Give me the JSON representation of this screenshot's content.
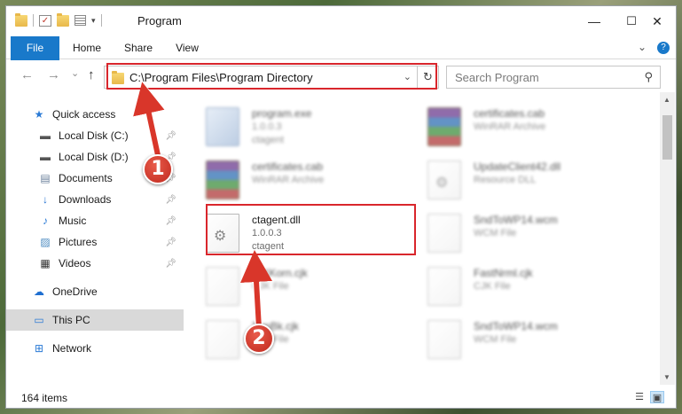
{
  "window": {
    "title": "Program",
    "controls": {
      "minimize": "—",
      "maximize": "☐",
      "close": "✕"
    }
  },
  "ribbon": {
    "tabs": [
      "File",
      "Home",
      "Share",
      "View"
    ],
    "expand_icon": "chevron-down-icon",
    "help_icon": "help-icon"
  },
  "nav": {
    "back": "←",
    "forward": "→",
    "recent": "⌄",
    "up": "↑",
    "address": "C:\\Program Files\\Program Directory",
    "refresh": "↻",
    "search_placeholder": "Search Program"
  },
  "sidebar": {
    "items": [
      {
        "label": "Quick access",
        "icon": "star-icon",
        "pinned": false
      },
      {
        "label": "Local Disk (C:)",
        "icon": "drive-icon",
        "pinned": true
      },
      {
        "label": "Local Disk (D:)",
        "icon": "drive-icon",
        "pinned": true
      },
      {
        "label": "Documents",
        "icon": "documents-icon",
        "pinned": true
      },
      {
        "label": "Downloads",
        "icon": "downloads-icon",
        "pinned": true
      },
      {
        "label": "Music",
        "icon": "music-icon",
        "pinned": true
      },
      {
        "label": "Pictures",
        "icon": "pictures-icon",
        "pinned": true
      },
      {
        "label": "Videos",
        "icon": "videos-icon",
        "pinned": true
      },
      {
        "label": "OneDrive",
        "icon": "cloud-icon",
        "pinned": false
      },
      {
        "label": "This PC",
        "icon": "computer-icon",
        "pinned": false,
        "selected": true
      },
      {
        "label": "Network",
        "icon": "network-icon",
        "pinned": false
      }
    ]
  },
  "files": [
    {
      "name": "program.exe",
      "line1": "1.0.0.3",
      "line2": "ctagent",
      "type": "exe",
      "blurred": true
    },
    {
      "name": "certificates.cab",
      "line1": "WinRAR Archive",
      "line2": "",
      "type": "archive",
      "blurred": true
    },
    {
      "name": "certificates.cab",
      "line1": "WinRAR Archive",
      "line2": "",
      "type": "archive",
      "blurred": true
    },
    {
      "name": "UpdateClient42.dll",
      "line1": "Resource DLL",
      "line2": "",
      "type": "dll",
      "blurred": true
    },
    {
      "name": "ctagent.dll",
      "line1": "1.0.0.3",
      "line2": "ctagent",
      "type": "dll",
      "blurred": false
    },
    {
      "name": "SndToWP14.wcm",
      "line1": "WCM File",
      "line2": "",
      "type": "generic",
      "blurred": true
    },
    {
      "name": "IEXKorn.cjk",
      "line1": "CJK File",
      "line2": "",
      "type": "generic",
      "blurred": true
    },
    {
      "name": "FastNrml.cjk",
      "line1": "CJK File",
      "line2": "",
      "type": "generic",
      "blurred": true
    },
    {
      "name": "TrmBk.cjk",
      "line1": "CJK File",
      "line2": "",
      "type": "generic",
      "blurred": true
    },
    {
      "name": "SndToWP14.wcm",
      "line1": "WCM File",
      "line2": "",
      "type": "generic",
      "blurred": true
    }
  ],
  "status": {
    "count": "164 items"
  },
  "callouts": {
    "one": "1",
    "two": "2"
  },
  "colors": {
    "accent": "#1979ca",
    "highlight": "#d9262c",
    "callout": "#d9362a"
  }
}
